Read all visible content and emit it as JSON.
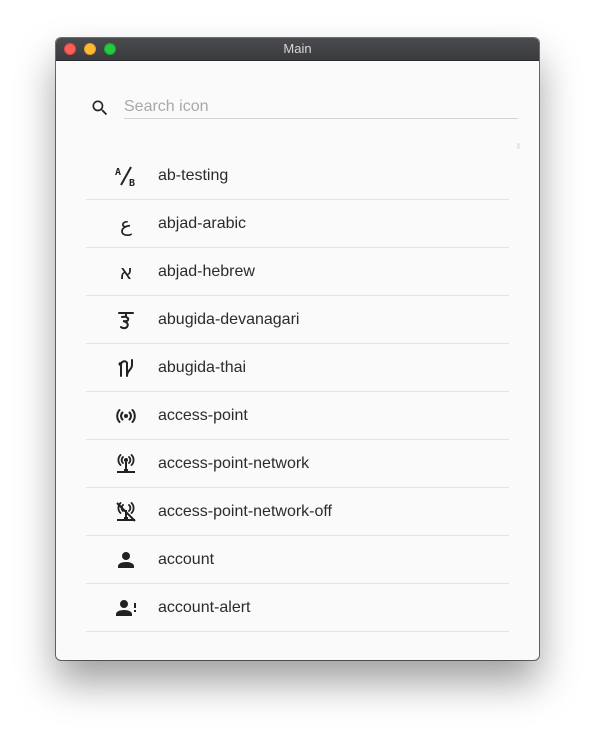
{
  "window": {
    "title": "Main"
  },
  "search": {
    "placeholder": "Search icon",
    "value": ""
  },
  "icons": [
    {
      "name": "ab-testing",
      "icon": "ab-testing-icon"
    },
    {
      "name": "abjad-arabic",
      "icon": "abjad-arabic-icon"
    },
    {
      "name": "abjad-hebrew",
      "icon": "abjad-hebrew-icon"
    },
    {
      "name": "abugida-devanagari",
      "icon": "abugida-devanagari-icon"
    },
    {
      "name": "abugida-thai",
      "icon": "abugida-thai-icon"
    },
    {
      "name": "access-point",
      "icon": "access-point-icon"
    },
    {
      "name": "access-point-network",
      "icon": "access-point-network-icon"
    },
    {
      "name": "access-point-network-off",
      "icon": "access-point-network-off-icon"
    },
    {
      "name": "account",
      "icon": "account-icon"
    },
    {
      "name": "account-alert",
      "icon": "account-alert-icon"
    }
  ],
  "colors": {
    "titlebar": "#3e3f42",
    "background": "#fafafa",
    "close": "#fc5f57",
    "minimize": "#fdbc2e",
    "maximize": "#28c840"
  }
}
